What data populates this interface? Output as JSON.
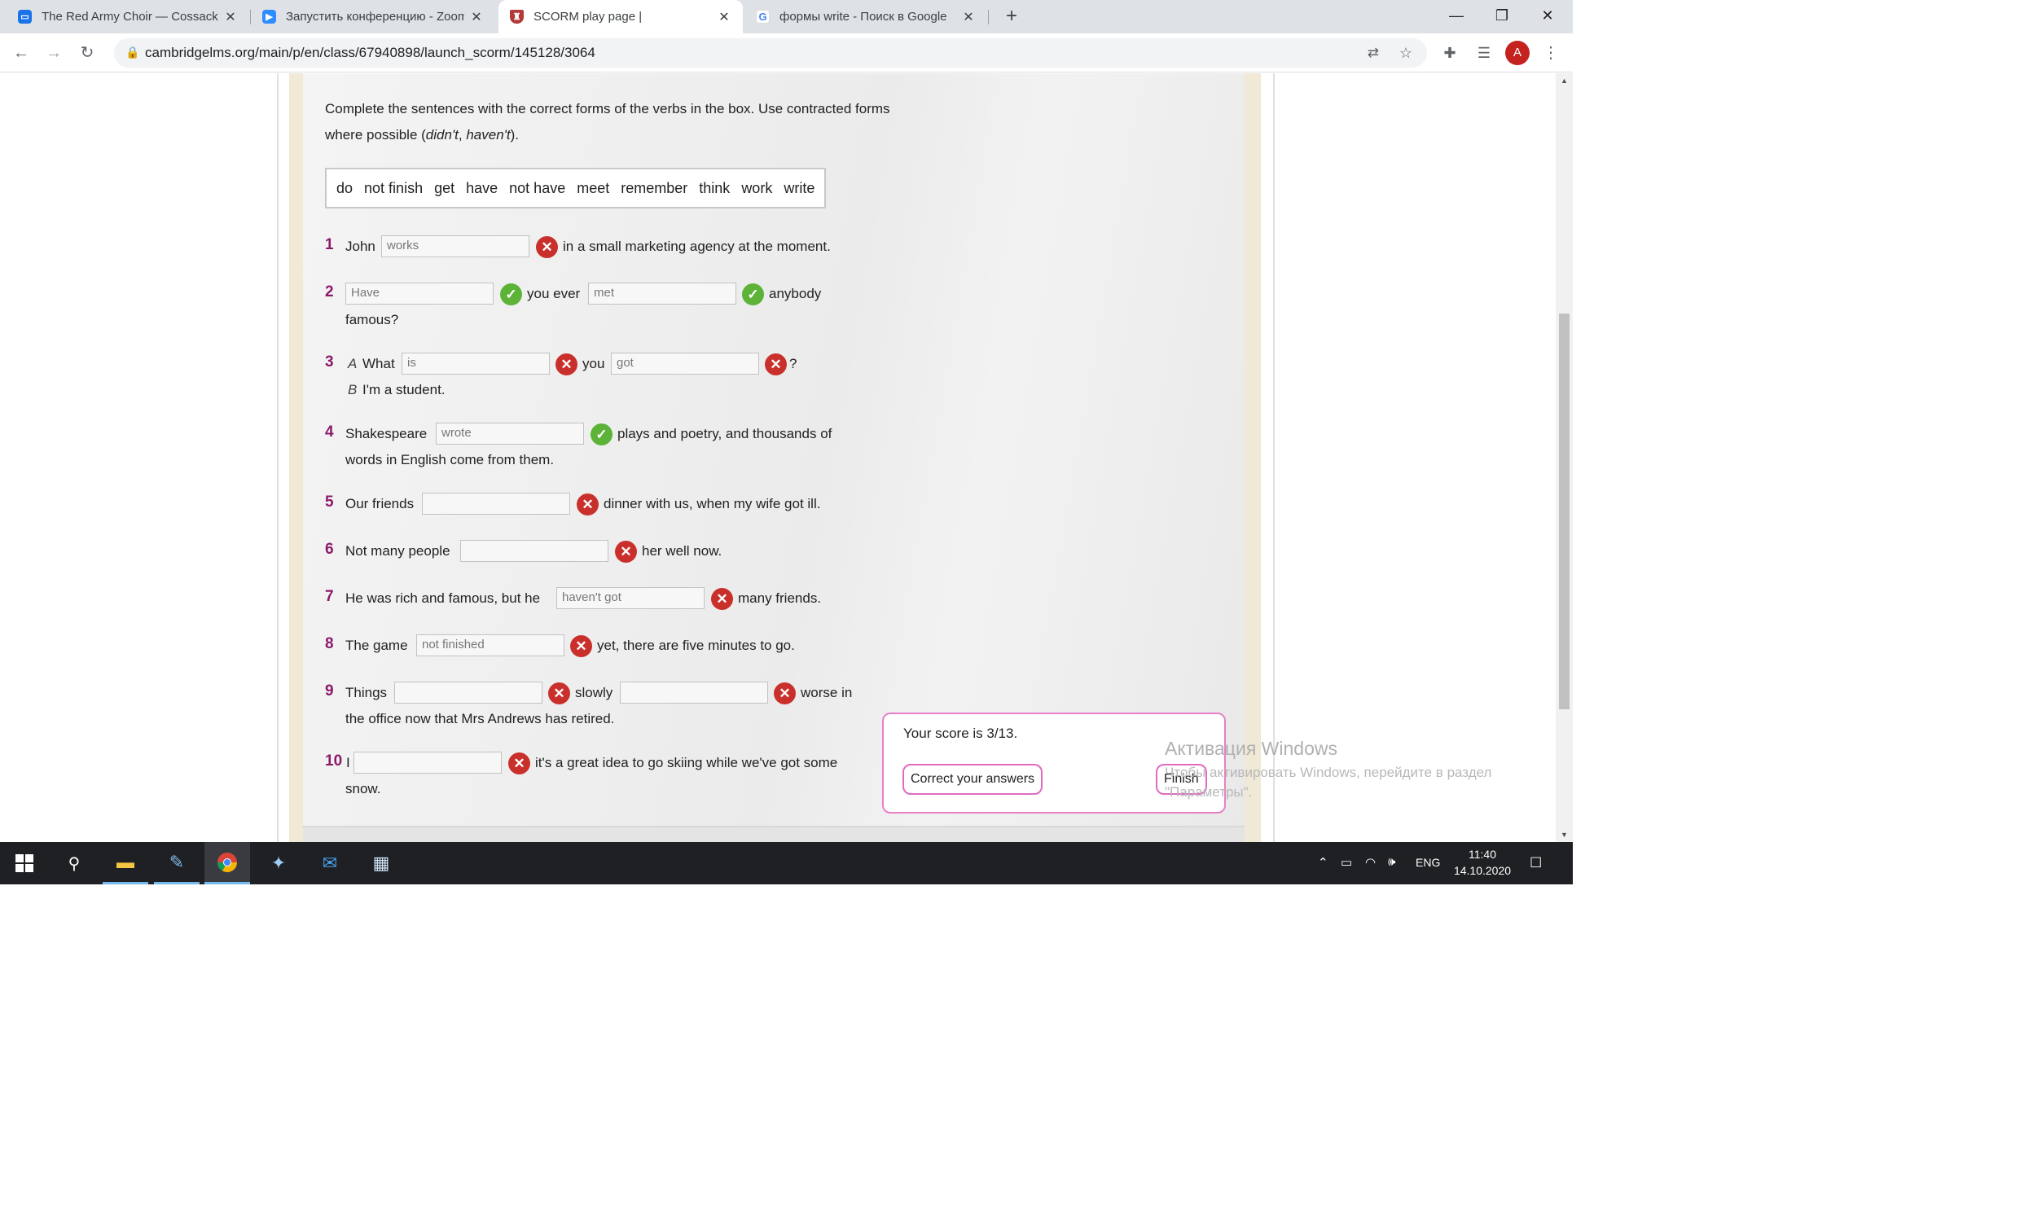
{
  "browser": {
    "tabs": [
      {
        "title": "The Red Army Choir — Cossack's",
        "icon": "chat-icon",
        "color": "#1a73e8"
      },
      {
        "title": "Запустить конференцию - Zoom",
        "icon": "zoom-icon",
        "color": "#2d8cff"
      },
      {
        "title": "SCORM play page |",
        "icon": "cambridge-shield-icon",
        "color": "#b33a3a"
      },
      {
        "title": "формы write - Поиск в Google",
        "icon": "google-icon",
        "color": "#4285f4"
      }
    ],
    "new_tab": "+",
    "window_controls": {
      "minimize": "—",
      "maximize": "❐",
      "close": "✕"
    },
    "url": "cambridgelms.org/main/p/en/class/67940898/launch_scorm/145128/3064",
    "avatar_letter": "A"
  },
  "exercise": {
    "instruction_parts": [
      "Complete the sentences with the correct forms of the verbs in the box. Use contracted forms where possible (",
      "didn't",
      ", ",
      "haven't",
      ")."
    ],
    "word_box": [
      "do",
      "not finish",
      "get",
      "have",
      "not have",
      "meet",
      "remember",
      "think",
      "work",
      "write"
    ],
    "questions": [
      {
        "num": "1",
        "parts": {
          "a": "John",
          "b": "in a small marketing agency at the moment."
        },
        "answers": [
          "works"
        ],
        "results": [
          "wrong"
        ]
      },
      {
        "num": "2",
        "parts": {
          "a": "you ever",
          "b": "anybody",
          "c": "famous?"
        },
        "answers": [
          "Have",
          "met"
        ],
        "results": [
          "right",
          "right"
        ]
      },
      {
        "num": "3",
        "parts": {
          "speaker_a": "A",
          "a": "What",
          "b": "you",
          "c": "?",
          "speaker_b": "B",
          "d": "I'm a student."
        },
        "answers": [
          "is",
          "got"
        ],
        "results": [
          "wrong",
          "wrong"
        ]
      },
      {
        "num": "4",
        "parts": {
          "a": "Shakespeare",
          "b": "plays and poetry, and thousands of",
          "c": "words in English come from them."
        },
        "answers": [
          "wrote"
        ],
        "results": [
          "right"
        ]
      },
      {
        "num": "5",
        "parts": {
          "a": "Our friends",
          "b": "dinner with us, when my wife got ill."
        },
        "answers": [
          ""
        ],
        "results": [
          "wrong"
        ]
      },
      {
        "num": "6",
        "parts": {
          "a": "Not many people",
          "b": "her well now."
        },
        "answers": [
          ""
        ],
        "results": [
          "wrong"
        ]
      },
      {
        "num": "7",
        "parts": {
          "a": "He was rich and famous, but he",
          "b": "many friends."
        },
        "answers": [
          "haven't got"
        ],
        "results": [
          "wrong"
        ]
      },
      {
        "num": "8",
        "parts": {
          "a": "The game",
          "b": "yet, there are five minutes to go."
        },
        "answers": [
          "not finished"
        ],
        "results": [
          "wrong"
        ]
      },
      {
        "num": "9",
        "parts": {
          "a": "Things",
          "b": "slowly",
          "c": "worse in",
          "d": "the office now that Mrs Andrews has retired."
        },
        "answers": [
          "",
          ""
        ],
        "results": [
          "wrong",
          "wrong"
        ]
      },
      {
        "num": "10",
        "parts": {
          "a": "I",
          "b": "it's a great idea to go skiing while we've got some",
          "c": "snow."
        },
        "answers": [
          ""
        ],
        "results": [
          "wrong"
        ]
      }
    ]
  },
  "score_popup": {
    "text": "Your score is 3/13.",
    "correct_button": "Correct your answers",
    "finish_button": "Finish"
  },
  "watermark": {
    "title": "Активация Windows",
    "line1": "Чтобы активировать Windows, перейдите в раздел",
    "line2": "\"Параметры\"."
  },
  "taskbar": {
    "tray": {
      "lang": "ENG"
    },
    "clock": {
      "time": "11:40",
      "date": "14.10.2020"
    }
  }
}
